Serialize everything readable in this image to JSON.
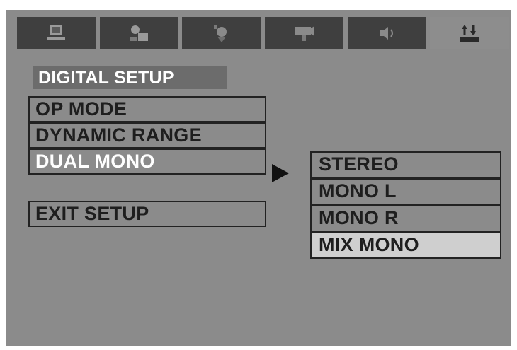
{
  "tabs": [
    {
      "icon": "monitor-icon",
      "glyph": ""
    },
    {
      "icon": "settings-icon",
      "glyph": ""
    },
    {
      "icon": "speaker-icon",
      "glyph": ""
    },
    {
      "icon": "video-icon",
      "glyph": ""
    },
    {
      "icon": "audio-icon",
      "glyph": ""
    },
    {
      "icon": "digital-setup-icon",
      "glyph": "⇅"
    }
  ],
  "menu": {
    "title": "DIGITAL SETUP",
    "items": [
      "OP MODE",
      "DYNAMIC RANGE",
      "DUAL MONO"
    ],
    "exit": "EXIT SETUP",
    "selected_item": "DUAL MONO"
  },
  "submenu": {
    "options": [
      "STEREO",
      "MONO L",
      "MONO R",
      "MIX MONO"
    ],
    "highlighted": "MIX MONO"
  },
  "colors": {
    "background": "#8b8b8b",
    "tab_inactive": "#3f3f3f",
    "title_bar": "#6c6c6c",
    "highlight": "#cfcfcf"
  }
}
